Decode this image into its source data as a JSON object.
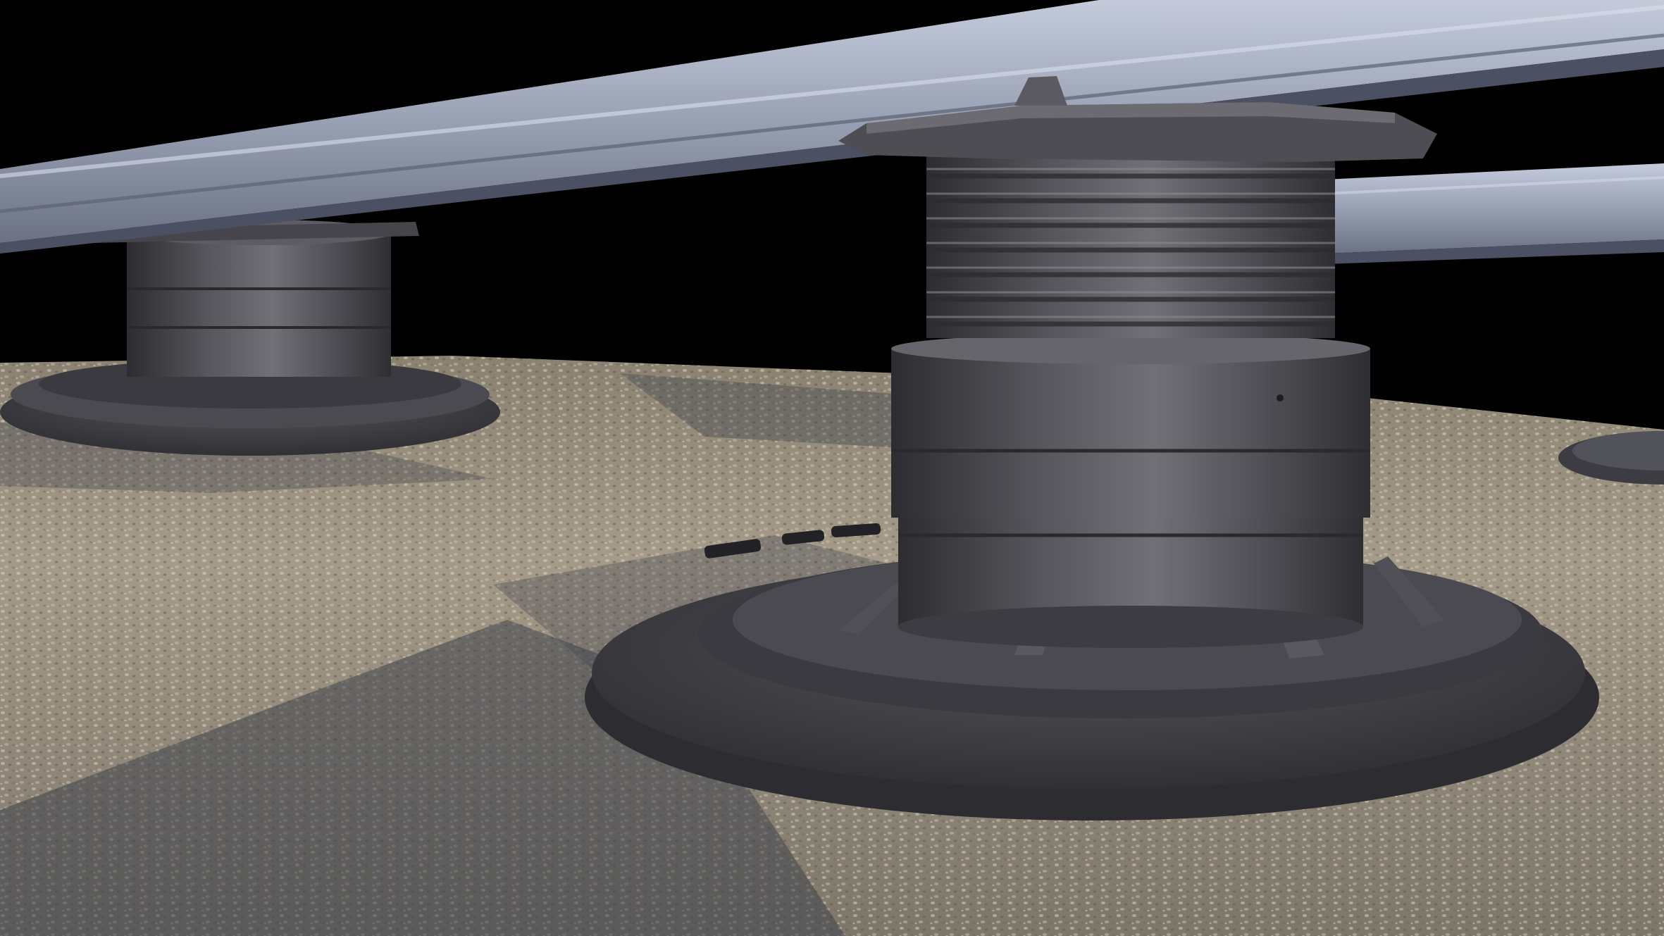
{
  "scene": {
    "subject": "adjustable-pedestal-supports-with-joists",
    "objects": [
      "gravel-ground",
      "aluminum-joist-left",
      "aluminum-joist-right",
      "pedestal-large",
      "pedestal-small",
      "pedestal-edge"
    ],
    "colors": {
      "background": "#000000",
      "gravel_light": "#bdb3a0",
      "gravel_mid": "#8f8676",
      "gravel_dark": "#5f5a52",
      "shadow": "#4a4d55",
      "plastic_dark": "#34343a",
      "plastic_mid": "#4a4a50",
      "plastic_light": "#6a6a70",
      "aluminum_light": "#b7bfd0",
      "aluminum_mid": "#8f97aa",
      "aluminum_dark": "#606778"
    }
  }
}
